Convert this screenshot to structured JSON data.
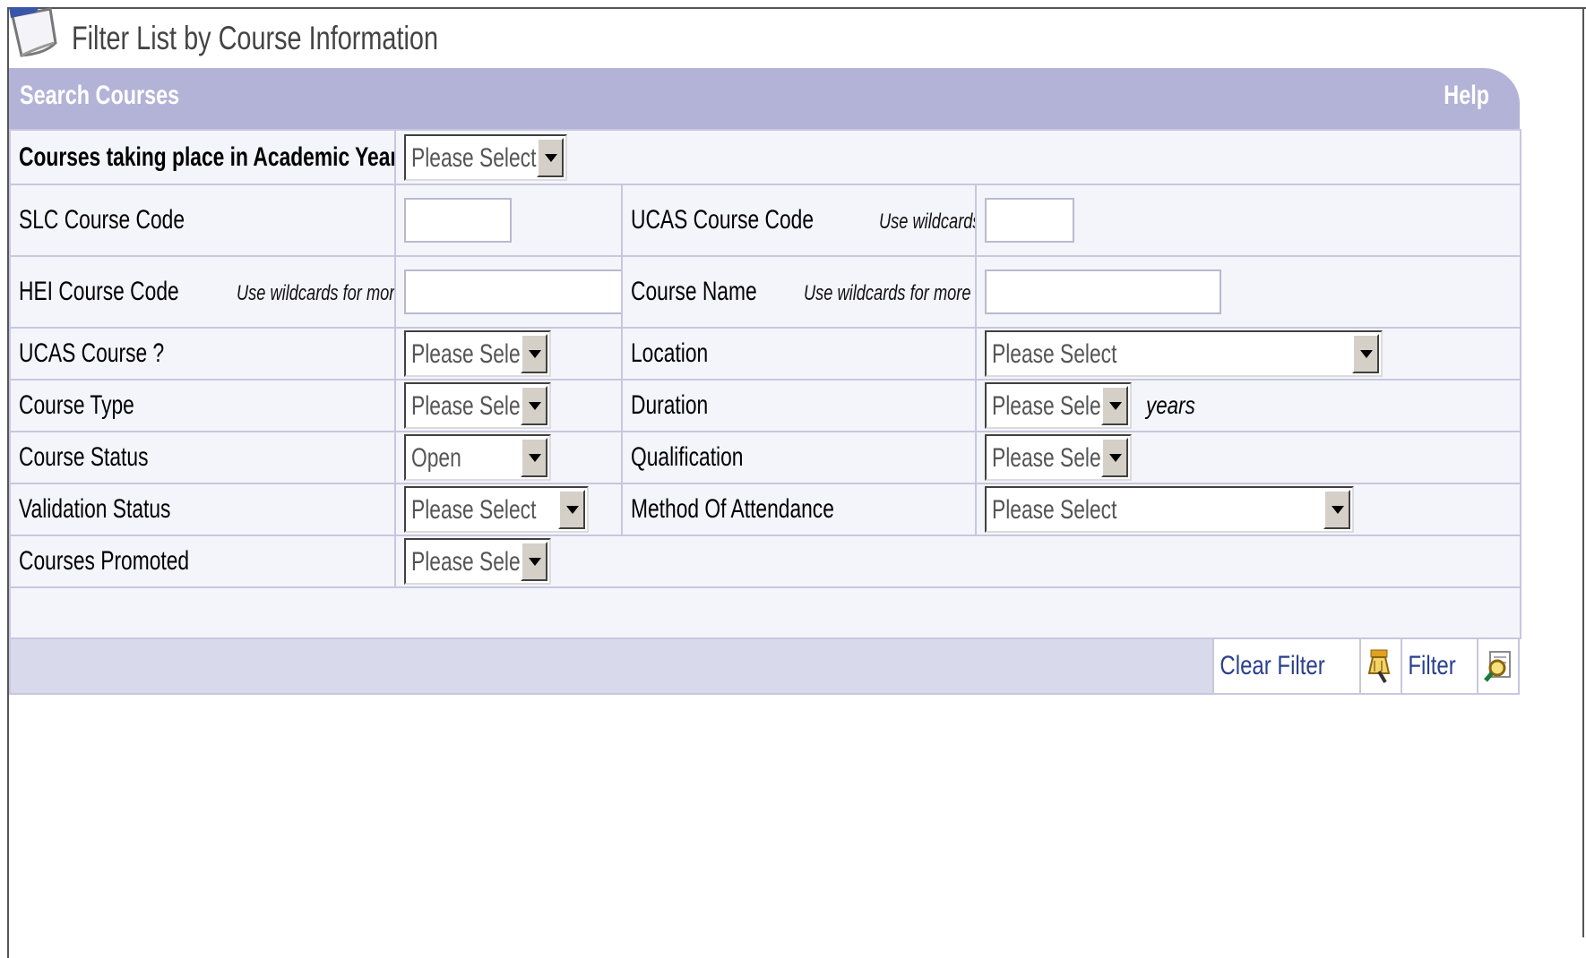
{
  "page": {
    "title": "Filter List by Course Information"
  },
  "panel": {
    "title": "Search Courses",
    "help": "Help"
  },
  "rows": {
    "academic_year": {
      "label": "Courses taking place in Academic Year",
      "value": "Please Select"
    },
    "slc_course_code": {
      "label": "SLC Course Code",
      "value": ""
    },
    "ucas_course_code": {
      "label": "UCAS Course Code",
      "hint": "Use wildcards for more matches, e.g. %AB%",
      "value": ""
    },
    "hei_course_code": {
      "label": "HEI Course Code",
      "hint": "Use wildcards for more matches, e.g. %AB%",
      "value": ""
    },
    "course_name": {
      "label": "Course Name",
      "hint": "Use wildcards for more matches, e.g. %Math%",
      "value": ""
    },
    "ucas_course": {
      "label": "UCAS Course ?",
      "value": "Please Select"
    },
    "location": {
      "label": "Location",
      "value": "Please Select"
    },
    "course_type": {
      "label": "Course Type",
      "value": "Please Select"
    },
    "duration": {
      "label": "Duration",
      "value": "Please Select",
      "unit": "years"
    },
    "course_status": {
      "label": "Course Status",
      "value": "Open"
    },
    "qualification": {
      "label": "Qualification",
      "value": "Please Select"
    },
    "validation_status": {
      "label": "Validation Status",
      "value": "Please Select"
    },
    "method_of_attendance": {
      "label": "Method Of Attendance",
      "value": "Please Select"
    },
    "courses_promoted": {
      "label": "Courses Promoted",
      "value": "Please Select"
    }
  },
  "buttons": {
    "clear_filter": "Clear Filter",
    "filter": "Filter"
  },
  "icons": {
    "page": "document-icon",
    "clear": "broom-icon",
    "filter": "magnifier-document-icon"
  },
  "colors": {
    "header": "#b3b3d7",
    "row_bg": "#f4f4fb",
    "border": "#c7c7df",
    "link": "#2a3f8f"
  }
}
